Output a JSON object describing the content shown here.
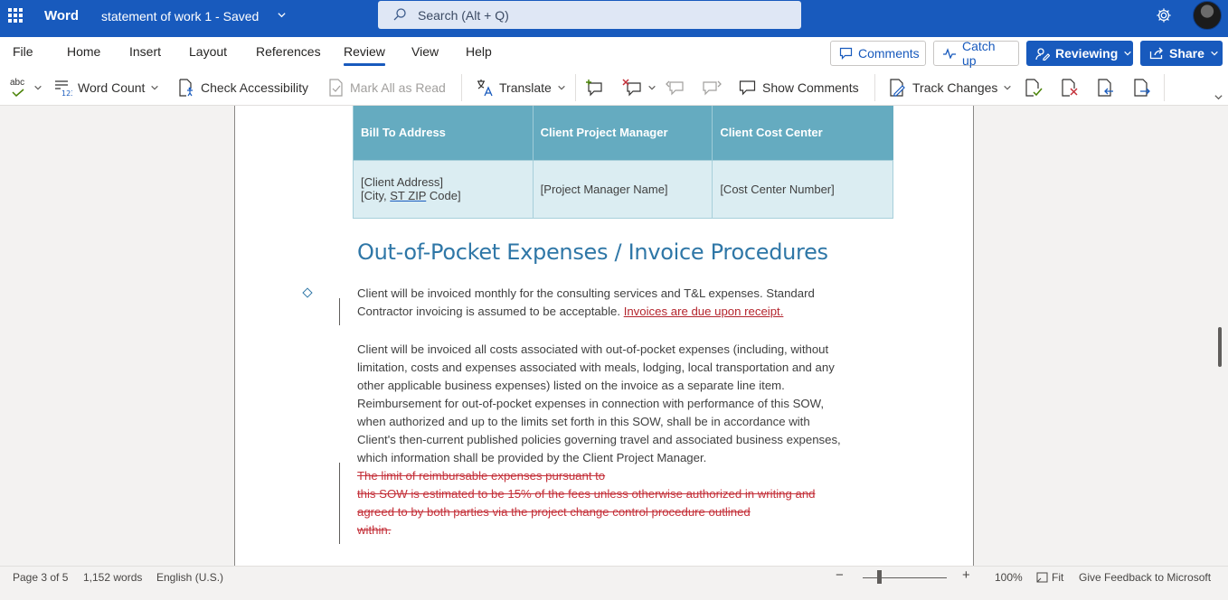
{
  "app": {
    "name": "Word",
    "doc_title": "statement of work 1  -  Saved",
    "search_placeholder": "Search (Alt + Q)"
  },
  "menu": {
    "tabs": [
      "File",
      "Home",
      "Insert",
      "Layout",
      "References",
      "Review",
      "View",
      "Help"
    ],
    "active_tab": "Review",
    "comments_label": "Comments",
    "catchup_label": "Catch up",
    "reviewing_label": "Reviewing",
    "share_label": "Share"
  },
  "ribbon": {
    "spelling_label": "abc",
    "word_count": "Word Count",
    "check_accessibility": "Check Accessibility",
    "mark_all_read": "Mark All as Read",
    "translate": "Translate",
    "show_comments": "Show Comments",
    "track_changes": "Track Changes"
  },
  "document": {
    "table": {
      "headers": [
        "Bill To Address",
        "Client Project Manager",
        "Client Cost Center"
      ],
      "address_line1": "[Client Address]",
      "address_line2_pre": "[City, ",
      "address_line2_zip": "ST  ZIP",
      "address_line2_post": " Code]",
      "project_manager": "[Project Manager Name]",
      "cost_center": "[Cost Center Number]"
    },
    "heading": "Out-of-Pocket Expenses / Invoice Procedures",
    "para1_line1": "Client will be invoiced monthly for the consulting services and T&L expenses. Standard",
    "para1_line2": "Contractor invoicing is assumed to be acceptable. ",
    "para1_inserted": "Invoices are due upon receipt.",
    "para2": [
      "Client will be invoiced all costs associated with out-of-pocket expenses (including, without",
      "limitation, costs and expenses associated with meals, lodging, local transportation and any",
      "other applicable business expenses) listed on the invoice as a separate line item.",
      "Reimbursement for out-of-pocket expenses in connection with performance of this SOW,",
      "when authorized and up to the limits set forth in this SOW, shall be in accordance with",
      "Client's then-current published policies governing travel and associated business expenses,",
      "which information shall be provided by the Client Project Manager."
    ],
    "deleted": [
      "The limit of reimbursable expenses pursuant to",
      " this SOW is estimated to be 15% of the fees unless otherwise authorized in writing and",
      "agreed to by both parties via the project change control procedure outlined",
      " within."
    ]
  },
  "status": {
    "page": "Page 3 of 5",
    "words": "1,152 words",
    "language": "English (U.S.)",
    "zoom_percent": "100%",
    "fit": "Fit",
    "feedback": "Give Feedback to Microsoft",
    "zoom_out": "−",
    "zoom_in": "+"
  },
  "colors": {
    "brand": "#185abd",
    "table_header": "#65abc0",
    "table_cell": "#dbedf2",
    "heading": "#2f77a7",
    "tracked": "#c4313a"
  }
}
